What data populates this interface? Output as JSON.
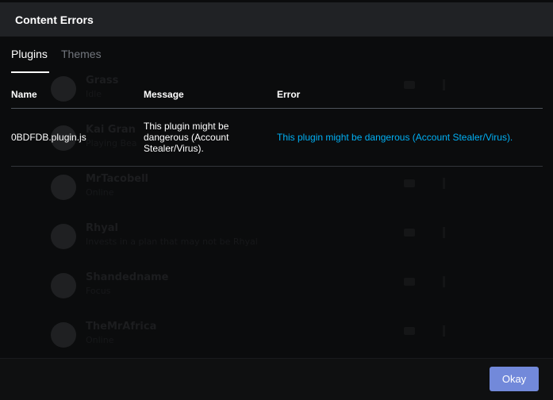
{
  "window": {
    "title": "Content Errors"
  },
  "tabs": [
    {
      "label": "Plugins",
      "active": true
    },
    {
      "label": "Themes",
      "active": false
    }
  ],
  "table": {
    "columns": [
      "Name",
      "Message",
      "Error"
    ],
    "rows": [
      {
        "name": "0BDFDB.plugin.js",
        "message": "This plugin might be dangerous (Account Stealer/Virus).",
        "error": "This plugin might be dangerous (Account Stealer/Virus)."
      }
    ]
  },
  "background_list": [
    {
      "name": "Grass",
      "status": "Idle"
    },
    {
      "name": "Kai Gran",
      "status": "Playing Bea"
    },
    {
      "name": "MrTacobell",
      "status": "Online"
    },
    {
      "name": "Rhyal",
      "status": "Invests in a plan that may not be Rhyal"
    },
    {
      "name": "Shandedname",
      "status": "Focus"
    },
    {
      "name": "TheMrAfrica",
      "status": "Online"
    }
  ],
  "footer": {
    "okay_label": "Okay"
  },
  "colors": {
    "accent": "#7289da",
    "link": "#00b0f4",
    "header_bg": "#202225",
    "body_bg": "#0b0c0d"
  }
}
